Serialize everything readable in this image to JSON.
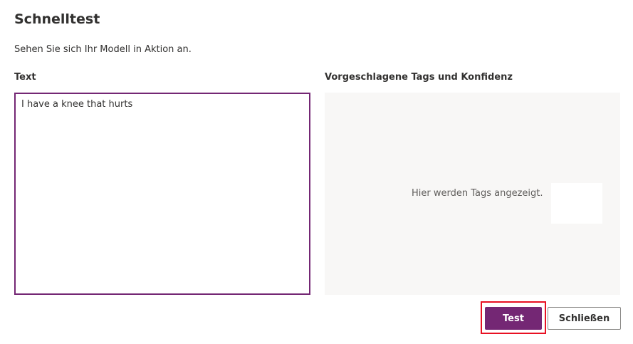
{
  "dialog": {
    "title": "Schnelltest",
    "subtitle": "Sehen Sie sich Ihr Modell in Aktion an."
  },
  "input": {
    "label": "Text",
    "value": "I have a knee that hurts"
  },
  "tags": {
    "label": "Vorgeschlagene Tags und Konfidenz",
    "placeholder": "Hier werden Tags angezeigt."
  },
  "buttons": {
    "test_label": "Test",
    "close_label": "Schließen"
  },
  "colors": {
    "accent": "#742774",
    "highlight": "#e81123",
    "panel_bg": "#f8f7f6"
  }
}
